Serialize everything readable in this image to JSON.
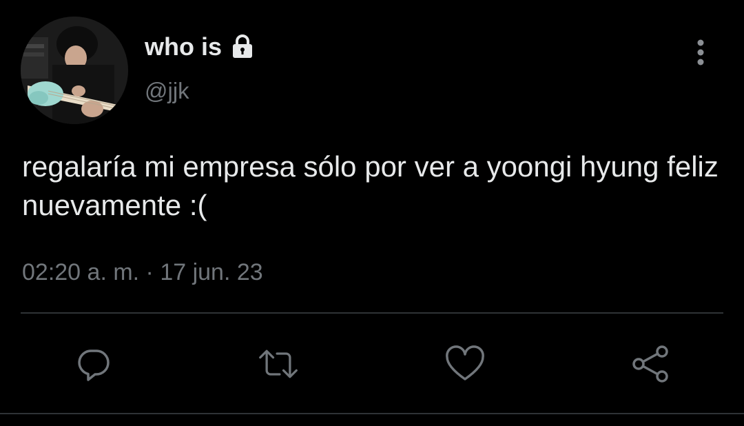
{
  "tweet": {
    "author": {
      "display_name": "who is",
      "handle": "@jjk",
      "protected_icon": "lock-icon",
      "avatar": "avatar-photo"
    },
    "text": "regalaría mi empresa sólo por ver a yoongi hyung feliz nuevamente :(",
    "timestamp": "02:20 a. m. · 17 jun. 23"
  },
  "actions": [
    {
      "icon": "reply-icon"
    },
    {
      "icon": "retweet-icon"
    },
    {
      "icon": "like-icon"
    },
    {
      "icon": "share-icon"
    }
  ],
  "colors": {
    "background": "#000000",
    "text_primary": "#e7e9ea",
    "text_secondary": "#71767b",
    "divider": "#2f3336"
  }
}
